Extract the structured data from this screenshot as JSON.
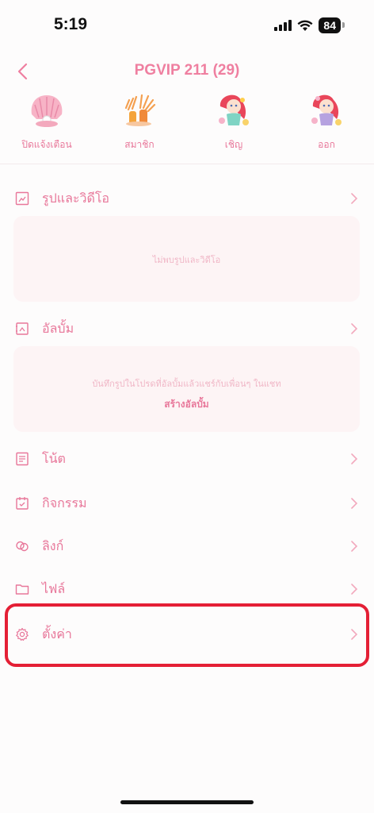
{
  "status_bar": {
    "time": "5:19",
    "battery": "84"
  },
  "header": {
    "title": "PGVIP 211 (29)"
  },
  "actions": [
    {
      "label": "ปิดแจ้งเตือน",
      "icon": "shell-icon"
    },
    {
      "label": "สมาชิก",
      "icon": "anemone-icon"
    },
    {
      "label": "เชิญ",
      "icon": "mermaid-icon"
    },
    {
      "label": "ออก",
      "icon": "mermaid-icon"
    }
  ],
  "sections": {
    "photos": {
      "label": "รูปและวิดีโอ",
      "empty_text": "ไม่พบรูปและวิดีโอ"
    },
    "albums": {
      "label": "อัลบั้ม",
      "empty_text": "บันทึกรูปในโปรดที่อัลบั้มแล้วแชร์กับเพื่อนๆ ในแชท",
      "create_label": "สร้างอัลบั้ม"
    },
    "notes": {
      "label": "โน้ต"
    },
    "events": {
      "label": "กิจกรรม"
    },
    "links": {
      "label": "ลิงก์"
    },
    "files": {
      "label": "ไฟล์"
    },
    "settings": {
      "label": "ตั้งค่า"
    }
  },
  "colors": {
    "accent": "#e8779a",
    "highlight": "#e41f35"
  }
}
